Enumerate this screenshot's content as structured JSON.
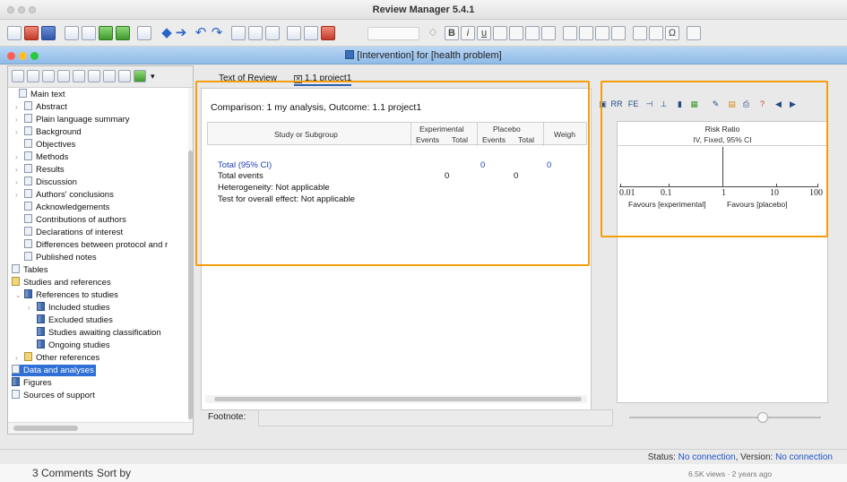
{
  "app": {
    "title": "Review Manager 5.4.1",
    "document_title": "[Intervention] for [health problem]"
  },
  "colors": {
    "highlight_box": "#f59e0b",
    "selection": "#2f6fd6",
    "link_blue": "#1f3fb5",
    "status_blue": "#1f52c7"
  },
  "toolbar": {
    "icons": [
      "new-doc-icon",
      "open-folder-icon",
      "save-icon",
      "home-icon",
      "import-icon",
      "export-icon",
      "print-icon",
      "back-arrow-icon",
      "forward-arrow-icon",
      "undo-icon",
      "redo-icon",
      "cut-icon",
      "copy-icon",
      "paste-icon",
      "spell-check-icon",
      "bold-icon",
      "italic-icon",
      "underline-icon",
      "superscript-icon",
      "subscript-icon",
      "bullet-list-icon",
      "numbered-list-icon",
      "indent-icon",
      "outdent-icon",
      "omega-icon"
    ],
    "bold": "B",
    "italic": "i",
    "underline": "u",
    "omega": "Ω"
  },
  "sidebar": {
    "items": [
      {
        "label": "Main text"
      },
      {
        "label": "Abstract"
      },
      {
        "label": "Plain language summary"
      },
      {
        "label": "Background"
      },
      {
        "label": "Objectives"
      },
      {
        "label": "Methods"
      },
      {
        "label": "Results"
      },
      {
        "label": "Discussion"
      },
      {
        "label": "Authors' conclusions"
      },
      {
        "label": "Acknowledgements"
      },
      {
        "label": "Contributions of authors"
      },
      {
        "label": "Declarations of interest"
      },
      {
        "label": "Differences between protocol and r"
      },
      {
        "label": "Published notes"
      },
      {
        "label": "Tables"
      },
      {
        "label": "Studies and references"
      },
      {
        "label": "References to studies"
      },
      {
        "label": "Included studies"
      },
      {
        "label": "Excluded studies"
      },
      {
        "label": "Studies awaiting classification"
      },
      {
        "label": "Ongoing studies"
      },
      {
        "label": "Other references"
      },
      {
        "label": "Data and analyses"
      },
      {
        "label": "Figures"
      },
      {
        "label": "Sources of support"
      }
    ]
  },
  "tabs": [
    {
      "label": "Text of Review"
    },
    {
      "label": "1.1 project1"
    }
  ],
  "analysis": {
    "comparison": "Comparison: 1 my analysis, Outcome: 1.1 project1",
    "headers": {
      "study": "Study or Subgroup",
      "experimental": "Experimental",
      "placebo": "Placebo",
      "events": "Events",
      "total": "Total",
      "weight": "Weigh"
    },
    "rows": {
      "total_label": "Total (95% CI)",
      "total_exp": "0",
      "total_pla": "0",
      "events_label": "Total events",
      "events_exp": "0",
      "events_pla": "0",
      "heterogeneity": "Heterogeneity: Not applicable",
      "overall": "Test for overall effect: Not applicable"
    },
    "footnote_label": "Footnote:"
  },
  "forest": {
    "title": "Risk Ratio",
    "subtitle": "IV, Fixed, 95% CI",
    "ticks": [
      "0.01",
      "0.1",
      "1",
      "10",
      "100"
    ],
    "favours_left": "Favours [experimental]",
    "favours_right": "Favours [placebo]",
    "tool_labels": [
      "RR",
      "FE"
    ]
  },
  "status": {
    "prefix": "Status: ",
    "connection": "No connection",
    "version_prefix": ", Version: ",
    "version": "No connection"
  },
  "background_page": {
    "comments": "3 Comments",
    "sort": "Sort by",
    "views": "6.5K views · 2 years ago"
  }
}
